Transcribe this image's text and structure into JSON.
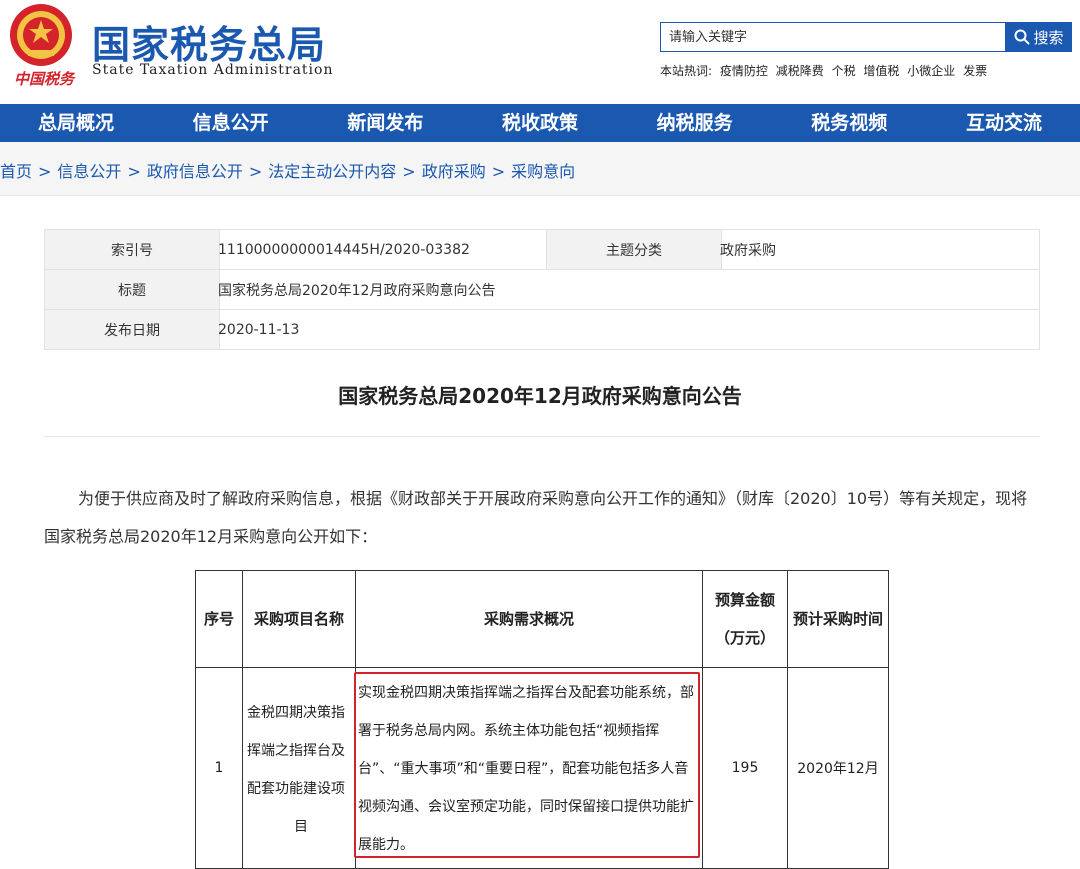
{
  "header": {
    "emblem_text": "中国税务",
    "site_name_cn": "国家税务总局",
    "site_name_en": "State Taxation Administration",
    "search": {
      "placeholder": "请输入关键字",
      "button_label": "搜索"
    },
    "hotwords_label": "本站热词:",
    "hotwords": [
      "疫情防控",
      "减税降费",
      "个税",
      "增值税",
      "小微企业",
      "发票"
    ]
  },
  "nav": [
    "总局概况",
    "信息公开",
    "新闻发布",
    "税收政策",
    "纳税服务",
    "税务视频",
    "互动交流"
  ],
  "breadcrumb": [
    "首页",
    "信息公开",
    "政府信息公开",
    "法定主动公开内容",
    "政府采购",
    "采购意向"
  ],
  "breadcrumb_sep": ">",
  "info": {
    "index_label": "索引号",
    "index_value": "11100000000014445H/2020-03382",
    "topic_label": "主题分类",
    "topic_value": "政府采购",
    "title_label": "标题",
    "title_value": "国家税务总局2020年12月政府采购意向公告",
    "date_label": "发布日期",
    "date_value": "2020-11-13"
  },
  "article": {
    "title": "国家税务总局2020年12月政府采购意向公告",
    "paragraph": "为便于供应商及时了解政府采购信息，根据《财政部关于开展政府采购意向公开工作的通知》（财库〔2020〕10号）等有关规定，现将国家税务总局2020年12月采购意向公开如下："
  },
  "table": {
    "headers": [
      "序号",
      "采购项目名称",
      "采购需求概况",
      "预算金额（万元）",
      "预计采购时间"
    ],
    "rows": [
      {
        "no": "1",
        "name_main": "金税四期决策指挥端之指挥台及配套功能建设项",
        "name_last": "目",
        "demand": "实现金税四期决策指挥端之指挥台及配套功能系统，部署于税务总局内网。系统主体功能包括“视频指挥台”、“重大事项”和“重要日程”，配套功能包括多人音视频沟通、会议室预定功能，同时保留接口提供功能扩展能力。",
        "budget": "195",
        "time": "2020年12月"
      }
    ]
  },
  "colors": {
    "brand_blue": "#1b58b0",
    "highlight_red": "#d1242a"
  }
}
